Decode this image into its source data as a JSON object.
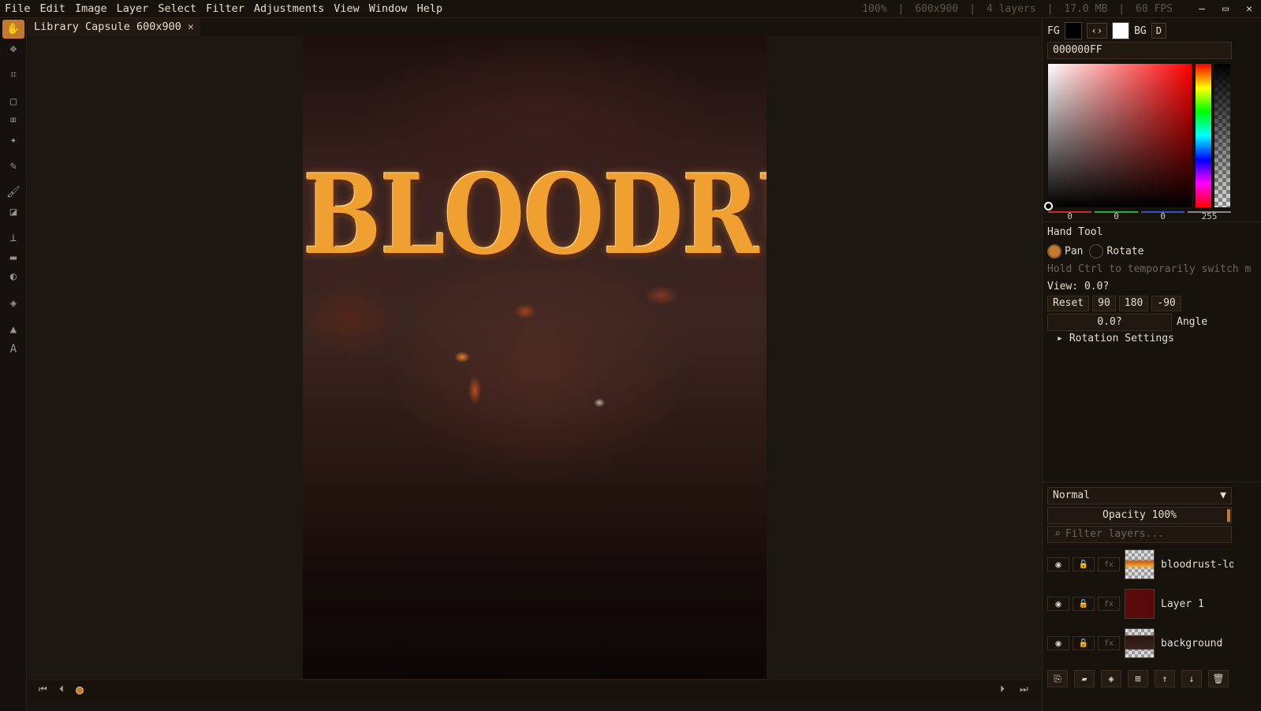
{
  "menu": [
    "File",
    "Edit",
    "Image",
    "Layer",
    "Select",
    "Filter",
    "Adjustments",
    "View",
    "Window",
    "Help"
  ],
  "status": {
    "zoom": "100%",
    "size": "600x900",
    "layers": "4 layers",
    "memory": "17.0 MB",
    "fps": "60 FPS"
  },
  "window_controls": {
    "minimize": "—",
    "maximize": "▭",
    "close": "✕"
  },
  "tools": [
    "hand",
    "move",
    "crop",
    "transform",
    "perspective",
    "magic-wand",
    "eyedropper",
    "brush",
    "eraser",
    "stamp",
    "gradient",
    "dodge",
    "fill",
    "shape",
    "text"
  ],
  "document_tab": {
    "title": "Library Capsule 600x900",
    "close": "✕"
  },
  "canvas": {
    "title_text": "BLOODRUST"
  },
  "timeline": {
    "buttons": [
      "⏮",
      "⏴",
      "⏵",
      "⏭"
    ]
  },
  "colors": {
    "fg_label": "FG",
    "bg_label": "BG",
    "swap_label": "‹›",
    "default_label": "D",
    "hex": "000000FF",
    "fg": "#000000",
    "bg": "#ffffff",
    "accent": "#c27a2f",
    "rgba": [
      "0",
      "0",
      "0",
      "255"
    ]
  },
  "tool_options": {
    "title": "Hand Tool",
    "pan": "Pan",
    "rotate": "Rotate",
    "hint": "Hold Ctrl to temporarily switch m",
    "view": "View: 0.0?",
    "buttons": [
      "Reset",
      "90",
      "180",
      "-90"
    ],
    "angle_value": "0.0?",
    "angle_label": "Angle",
    "rotation_settings": "Rotation Settings"
  },
  "layers_panel": {
    "blend_mode": "Normal",
    "opacity": "Opacity 100%",
    "filter_placeholder": "Filter layers...",
    "layers": [
      {
        "name": "bloodrust-log",
        "thumb": "logo"
      },
      {
        "name": "Layer 1",
        "thumb": "red"
      },
      {
        "name": "background",
        "thumb": "bg"
      }
    ],
    "fx_label": "fx"
  }
}
